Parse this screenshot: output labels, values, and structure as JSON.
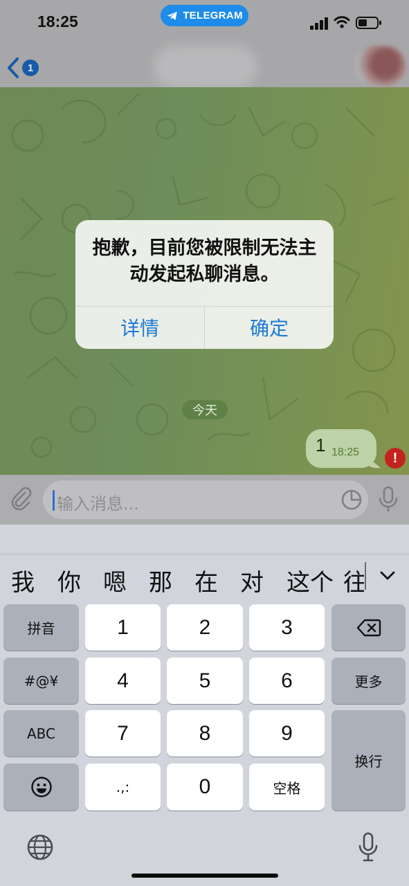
{
  "status_bar": {
    "time": "18:25",
    "app_pill": "TELEGRAM"
  },
  "header": {
    "back_badge": "1"
  },
  "chat": {
    "date_chip": "今天",
    "message": {
      "text": "1",
      "time": "18:25",
      "error_mark": "!"
    }
  },
  "composer": {
    "placeholder": "输入消息..."
  },
  "alert": {
    "message": "抱歉，目前您被限制无法主动发起私聊消息。",
    "details_button": "详情",
    "ok_button": "确定"
  },
  "keyboard": {
    "candidates": [
      "我",
      "你",
      "嗯",
      "那",
      "在",
      "对",
      "这个",
      "往"
    ],
    "keys": {
      "pinyin": "拼音",
      "symbols": "#@¥",
      "abc": "ABC",
      "more": "更多",
      "enter": "换行",
      "space": "空格",
      "punct": ".,:",
      "digits": [
        "1",
        "2",
        "3",
        "4",
        "5",
        "6",
        "7",
        "8",
        "9",
        "0"
      ]
    }
  },
  "colors": {
    "accent": "#1c7ad6",
    "telegram_blue": "#1e8ce8",
    "error_red": "#c3231e"
  },
  "icons": [
    "telegram-plane-icon",
    "signal-icon",
    "wifi-icon",
    "battery-icon",
    "back-chevron-icon",
    "attach-icon",
    "sticker-icon",
    "microphone-icon",
    "backspace-icon",
    "emoji-icon",
    "globe-icon",
    "chevron-down-icon"
  ]
}
